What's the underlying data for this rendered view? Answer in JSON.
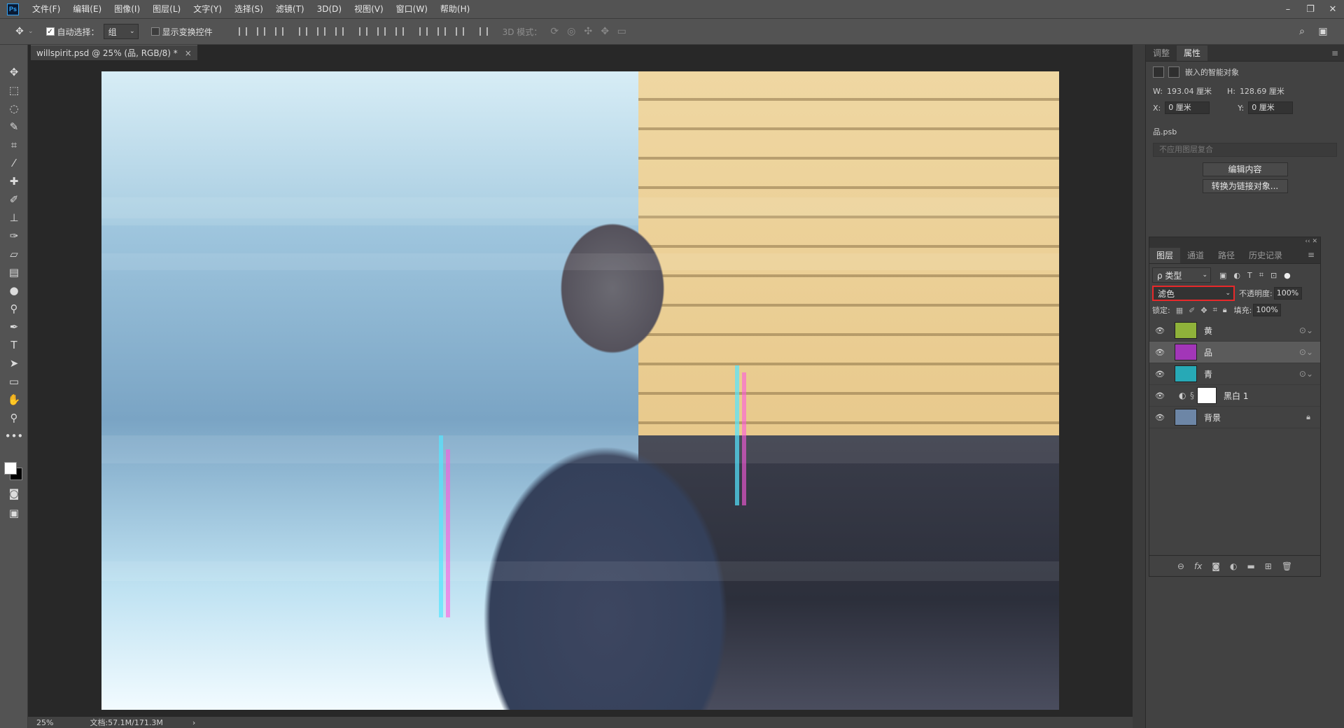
{
  "menu": {
    "logo": "Ps",
    "items": [
      "文件(F)",
      "编辑(E)",
      "图像(I)",
      "图层(L)",
      "文字(Y)",
      "选择(S)",
      "滤镜(T)",
      "3D(D)",
      "视图(V)",
      "窗口(W)",
      "帮助(H)"
    ]
  },
  "window_controls": [
    "–",
    "❐",
    "✕"
  ],
  "options": {
    "auto_select_label": "自动选择：",
    "auto_select_checked": true,
    "auto_select_value": "组",
    "show_transform_label": "显示变换控件",
    "show_transform_checked": false,
    "mode_3d_label": "3D 模式："
  },
  "document": {
    "tab_title": "willspirit.psd @ 25% (品, RGB/8) *",
    "close": "×"
  },
  "statusbar": {
    "zoom": "25%",
    "doc_info": "文档:57.1M/171.3M",
    "arrow": "›"
  },
  "properties": {
    "tabs": [
      "调整",
      "属性"
    ],
    "active_tab": "属性",
    "object_type": "嵌入的智能对象",
    "w_label": "W:",
    "w_value": "193.04 厘米",
    "h_label": "H:",
    "h_value": "128.69 厘米",
    "x_label": "X:",
    "x_value": "0 厘米",
    "y_label": "Y:",
    "y_value": "0 厘米",
    "file_name": "品.psb",
    "comp_placeholder": "不应用图层复合",
    "edit_button": "编辑内容",
    "convert_button": "转换为链接对象..."
  },
  "layers_panel": {
    "tabs": [
      "图层",
      "通道",
      "路径",
      "历史记录"
    ],
    "active_tab": "图层",
    "filter_label": "ρ 类型",
    "blend_mode": "滤色",
    "opacity_label": "不透明度:",
    "opacity_value": "100%",
    "lock_label": "锁定:",
    "fill_label": "填充:",
    "fill_value": "100%",
    "layers": [
      {
        "name": "黄",
        "selected": false,
        "thumb_color": "#8fb23a"
      },
      {
        "name": "品",
        "selected": true,
        "thumb_color": "#a236b8"
      },
      {
        "name": "青",
        "selected": false,
        "thumb_color": "#27a9b6"
      },
      {
        "name": "黑白 1",
        "selected": false,
        "thumb_color": "#ffffff"
      },
      {
        "name": "背景",
        "selected": false,
        "thumb_color": "#6d86a6"
      }
    ]
  }
}
